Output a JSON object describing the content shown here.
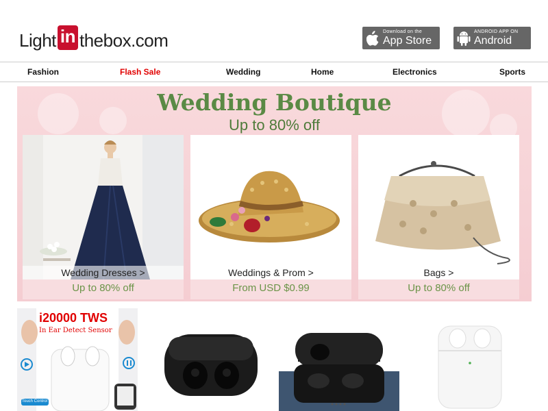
{
  "header": {
    "logo": {
      "part1": "Light",
      "part2": "in",
      "part3": "thebox",
      "part4": ".com"
    },
    "app_store": {
      "small": "Download on the",
      "big": "App Store"
    },
    "android": {
      "small": "ANDROID APP ON",
      "big": "Android"
    }
  },
  "nav": {
    "items": [
      "Fashion",
      "Flash Sale",
      "Wedding",
      "Home",
      "Electronics",
      "Sports"
    ]
  },
  "banner": {
    "title": "Wedding Boutique",
    "subtitle": "Up to 80% off",
    "cards": [
      {
        "label": "Wedding Dresses >",
        "promo": "Up to 80% off"
      },
      {
        "label": "Weddings & Prom >",
        "promo": "From USD $0.99"
      },
      {
        "label": "Bags >",
        "promo": "Up to 80% off"
      }
    ]
  },
  "products": {
    "tws_title": "i20000 TWS",
    "tws_subtitle": "In Ear Detect Sensor",
    "touch_label": "Touch Control"
  },
  "colors": {
    "brand_red": "#c8102e",
    "flash_sale": "#e10000",
    "banner_green": "#5a8a45",
    "banner_bg": "#f9d9dc"
  }
}
